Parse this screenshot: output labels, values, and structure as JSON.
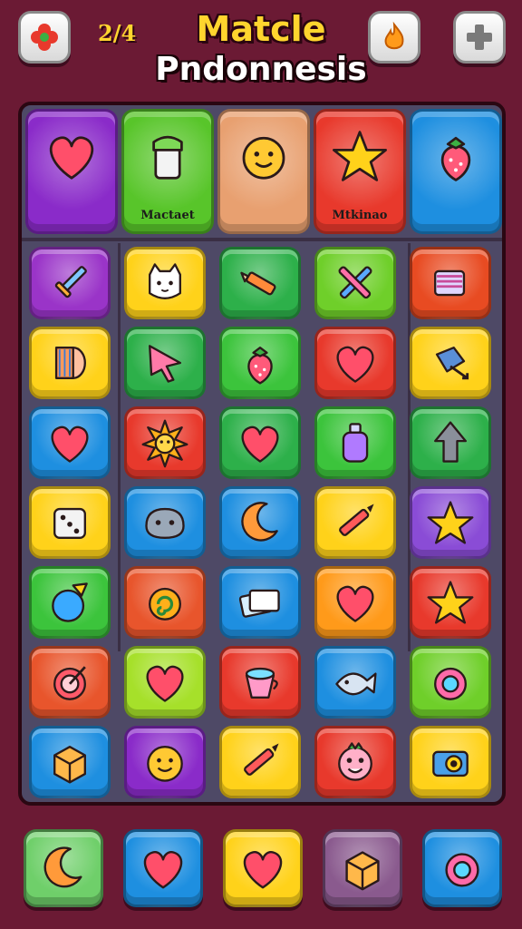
{
  "header": {
    "score": "2/4",
    "title_line1": "Matcle",
    "title_line2": "Pndonnesis",
    "left_button_icon": "flower-icon",
    "right_button_1_icon": "flame-icon",
    "right_button_2_icon": "plus-icon"
  },
  "featured": [
    {
      "icon": "heart-icon",
      "color": "#8a2bc9",
      "label": ""
    },
    {
      "icon": "jar-icon",
      "color": "#58c52a",
      "label": "Mactaet"
    },
    {
      "icon": "smiley-icon",
      "color": "#e8a070",
      "label": ""
    },
    {
      "icon": "star-icon",
      "color": "#e8392c",
      "label": "Mtkinao"
    },
    {
      "icon": "strawberry-icon",
      "color": "#1e8fe0",
      "label": ""
    }
  ],
  "grid": [
    [
      {
        "icon": "sword-icon",
        "color": "#9a34c8"
      },
      {
        "icon": "cat-icon",
        "color": "#ffd21a"
      },
      {
        "icon": "crayon-icon",
        "color": "#2db04a"
      },
      {
        "icon": "crossed-tools-icon",
        "color": "#6fcf2a"
      },
      {
        "icon": "scroll-icon",
        "color": "#e84b22"
      }
    ],
    [
      {
        "icon": "drum-icon",
        "color": "#ffd21a"
      },
      {
        "icon": "cursor-arrow-icon",
        "color": "#2db04a"
      },
      {
        "icon": "strawberry-icon",
        "color": "#3cc43c"
      },
      {
        "icon": "heart-icon",
        "color": "#e8392c"
      },
      {
        "icon": "cube-arrow-icon",
        "color": "#ffd21a"
      }
    ],
    [
      {
        "icon": "heart-icon",
        "color": "#1e8fe0"
      },
      {
        "icon": "sun-icon",
        "color": "#e8392c"
      },
      {
        "icon": "heart-icon",
        "color": "#2db04a"
      },
      {
        "icon": "bottle-icon",
        "color": "#3cc43c"
      },
      {
        "icon": "up-arrow-icon",
        "color": "#2db04a"
      }
    ],
    [
      {
        "icon": "dice-icon",
        "color": "#ffd21a"
      },
      {
        "icon": "creature-icon",
        "color": "#1e8fe0"
      },
      {
        "icon": "moon-icon",
        "color": "#1e8fe0"
      },
      {
        "icon": "pencil-icon",
        "color": "#ffd21a"
      },
      {
        "icon": "star-icon",
        "color": "#8a4cd6"
      }
    ],
    [
      {
        "icon": "ball-icon",
        "color": "#3cc43c"
      },
      {
        "icon": "swirl-icon",
        "color": "#e8552c"
      },
      {
        "icon": "books-icon",
        "color": "#1e8fe0"
      },
      {
        "icon": "heart-icon",
        "color": "#ff9a1a"
      },
      {
        "icon": "star-icon",
        "color": "#e8392c"
      }
    ],
    [
      {
        "icon": "target-icon",
        "color": "#e8552c"
      },
      {
        "icon": "heart-icon",
        "color": "#a6e02a"
      },
      {
        "icon": "cup-icon",
        "color": "#e8392c"
      },
      {
        "icon": "fish-icon",
        "color": "#1e8fe0"
      },
      {
        "icon": "gem-icon",
        "color": "#6fcf2a"
      }
    ],
    [
      {
        "icon": "box-icon",
        "color": "#1e8fe0"
      },
      {
        "icon": "smiley-icon",
        "color": "#8a2bc9"
      },
      {
        "icon": "pencil-icon",
        "color": "#ffd21a"
      },
      {
        "icon": "monster-icon",
        "color": "#e8392c"
      },
      {
        "icon": "camera-icon",
        "color": "#ffd21a"
      }
    ]
  ],
  "bottom_bar": [
    {
      "icon": "moon-icon",
      "color": "#6fcf6a"
    },
    {
      "icon": "heart-icon",
      "color": "#1e8fe0"
    },
    {
      "icon": "heart-icon",
      "color": "#ffd21a"
    },
    {
      "icon": "box-icon",
      "color": "#8a5a8e"
    },
    {
      "icon": "gem-icon",
      "color": "#1e8fe0"
    }
  ]
}
